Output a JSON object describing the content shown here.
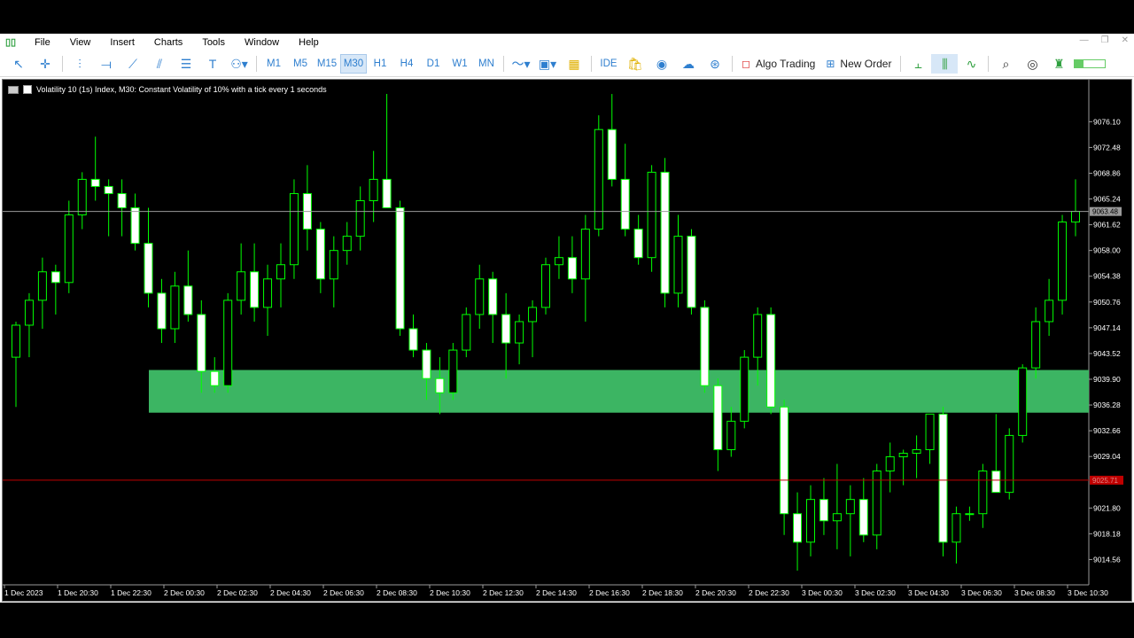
{
  "menu": [
    "File",
    "View",
    "Insert",
    "Charts",
    "Tools",
    "Window",
    "Help"
  ],
  "window_controls": [
    "—",
    "❐",
    "✕"
  ],
  "toolbar": {
    "timeframes": [
      "M1",
      "M5",
      "M15",
      "M30",
      "H1",
      "H4",
      "D1",
      "W1",
      "MN"
    ],
    "active_timeframe": "M30",
    "ide_label": "IDE",
    "algo_trading_label": "Algo Trading",
    "new_order_label": "New Order"
  },
  "chart": {
    "title": "Volatility 10 (1s) Index, M30:  Constant Volatility of 10% with a tick every 1 seconds",
    "current_price_label": "9063.48",
    "red_line_label": "9025.71",
    "background": "#000000",
    "bull_color": "#00ff00",
    "bear_fill": "#ffffff",
    "zone_color": "#3cb563",
    "red_line_color": "#c00000"
  },
  "chart_data": {
    "type": "candlestick",
    "title": "Volatility 10 (1s) Index, M30",
    "ylim": [
      9011.0,
      9082.0
    ],
    "y_ticks": [
      "9076.10",
      "9072.48",
      "9068.86",
      "9065.24",
      "9061.62",
      "9058.00",
      "9054.38",
      "9050.76",
      "9047.14",
      "9043.52",
      "9039.90",
      "9036.28",
      "9032.66",
      "9029.04",
      "9021.80",
      "9018.18",
      "9014.56"
    ],
    "x_ticks": [
      "1 Dec 2023",
      "1 Dec 20:30",
      "1 Dec 22:30",
      "2 Dec 00:30",
      "2 Dec 02:30",
      "2 Dec 04:30",
      "2 Dec 06:30",
      "2 Dec 08:30",
      "2 Dec 10:30",
      "2 Dec 12:30",
      "2 Dec 14:30",
      "2 Dec 16:30",
      "2 Dec 18:30",
      "2 Dec 20:30",
      "2 Dec 22:30",
      "3 Dec 00:30",
      "3 Dec 02:30",
      "3 Dec 04:30",
      "3 Dec 06:30",
      "3 Dec 08:30",
      "3 Dec 10:30"
    ],
    "zone": {
      "low": 9035.2,
      "high": 9041.2
    },
    "horizontal_lines": [
      {
        "price": 9063.48,
        "color": "#9a9a9a"
      },
      {
        "price": 9025.71,
        "color": "#c00000"
      }
    ],
    "candles": [
      [
        9043.0,
        9048.0,
        9036.0,
        9047.5
      ],
      [
        9047.5,
        9052.0,
        9043.0,
        9051.0
      ],
      [
        9051.0,
        9057.0,
        9047.0,
        9055.0
      ],
      [
        9055.0,
        9056.0,
        9049.0,
        9053.5
      ],
      [
        9053.5,
        9065.0,
        9052.0,
        9063.0
      ],
      [
        9063.0,
        9069.0,
        9061.0,
        9068.0
      ],
      [
        9068.0,
        9074.0,
        9065.0,
        9067.0
      ],
      [
        9067.0,
        9068.0,
        9060.0,
        9066.0
      ],
      [
        9066.0,
        9068.0,
        9060.0,
        9064.0
      ],
      [
        9064.0,
        9066.0,
        9058.0,
        9059.0
      ],
      [
        9059.0,
        9064.0,
        9050.0,
        9052.0
      ],
      [
        9052.0,
        9054.0,
        9045.0,
        9047.0
      ],
      [
        9047.0,
        9055.0,
        9045.0,
        9053.0
      ],
      [
        9053.0,
        9058.0,
        9048.0,
        9049.0
      ],
      [
        9049.0,
        9051.0,
        9038.0,
        9041.0
      ],
      [
        9041.0,
        9043.0,
        9038.0,
        9039.0
      ],
      [
        9039.0,
        9052.0,
        9038.0,
        9051.0
      ],
      [
        9051.0,
        9059.0,
        9049.0,
        9055.0
      ],
      [
        9055.0,
        9059.0,
        9048.0,
        9050.0
      ],
      [
        9050.0,
        9056.0,
        9046.0,
        9054.0
      ],
      [
        9054.0,
        9059.0,
        9050.0,
        9056.0
      ],
      [
        9056.0,
        9068.0,
        9054.0,
        9066.0
      ],
      [
        9066.0,
        9070.0,
        9058.0,
        9061.0
      ],
      [
        9061.0,
        9062.0,
        9052.0,
        9054.0
      ],
      [
        9054.0,
        9060.0,
        9050.0,
        9058.0
      ],
      [
        9058.0,
        9062.0,
        9056.0,
        9060.0
      ],
      [
        9060.0,
        9067.0,
        9058.0,
        9065.0
      ],
      [
        9065.0,
        9072.0,
        9062.0,
        9068.0
      ],
      [
        9068.0,
        9080.0,
        9064.0,
        9064.0
      ],
      [
        9064.0,
        9065.0,
        9046.0,
        9047.0
      ],
      [
        9047.0,
        9049.0,
        9043.0,
        9044.0
      ],
      [
        9044.0,
        9045.0,
        9037.0,
        9040.0
      ],
      [
        9040.0,
        9043.0,
        9035.0,
        9038.0
      ],
      [
        9038.0,
        9045.0,
        9037.0,
        9044.0
      ],
      [
        9044.0,
        9050.0,
        9043.0,
        9049.0
      ],
      [
        9049.0,
        9056.0,
        9047.0,
        9054.0
      ],
      [
        9054.0,
        9055.0,
        9045.0,
        9049.0
      ],
      [
        9049.0,
        9052.0,
        9040.0,
        9045.0
      ],
      [
        9045.0,
        9049.0,
        9042.0,
        9048.0
      ],
      [
        9048.0,
        9051.0,
        9043.0,
        9050.0
      ],
      [
        9050.0,
        9057.0,
        9049.0,
        9056.0
      ],
      [
        9056.0,
        9060.0,
        9054.0,
        9057.0
      ],
      [
        9057.0,
        9060.0,
        9052.0,
        9054.0
      ],
      [
        9054.0,
        9063.0,
        9048.0,
        9061.0
      ],
      [
        9061.0,
        9077.0,
        9060.0,
        9075.0
      ],
      [
        9075.0,
        9080.0,
        9067.0,
        9068.0
      ],
      [
        9068.0,
        9073.0,
        9060.0,
        9061.0
      ],
      [
        9061.0,
        9063.0,
        9056.0,
        9057.0
      ],
      [
        9057.0,
        9070.0,
        9055.0,
        9069.0
      ],
      [
        9069.0,
        9071.0,
        9050.0,
        9052.0
      ],
      [
        9052.0,
        9063.0,
        9050.0,
        9060.0
      ],
      [
        9060.0,
        9061.0,
        9049.0,
        9050.0
      ],
      [
        9050.0,
        9051.0,
        9038.0,
        9039.0
      ],
      [
        9039.0,
        9040.0,
        9027.0,
        9030.0
      ],
      [
        9030.0,
        9036.0,
        9029.0,
        9034.0
      ],
      [
        9034.0,
        9044.0,
        9033.0,
        9043.0
      ],
      [
        9043.0,
        9050.0,
        9039.0,
        9049.0
      ],
      [
        9049.0,
        9050.0,
        9035.0,
        9036.0
      ],
      [
        9036.0,
        9037.0,
        9018.0,
        9021.0
      ],
      [
        9021.0,
        9024.0,
        9013.0,
        9017.0
      ],
      [
        9017.0,
        9025.0,
        9015.0,
        9023.0
      ],
      [
        9023.0,
        9026.0,
        9018.0,
        9020.0
      ],
      [
        9020.0,
        9028.0,
        9016.0,
        9021.0
      ],
      [
        9021.0,
        9025.0,
        9015.0,
        9023.0
      ],
      [
        9023.0,
        9026.0,
        9017.0,
        9018.0
      ],
      [
        9018.0,
        9028.0,
        9016.0,
        9027.0
      ],
      [
        9027.0,
        9031.0,
        9024.0,
        9029.0
      ],
      [
        9029.0,
        9030.0,
        9025.0,
        9029.5
      ],
      [
        9029.5,
        9032.0,
        9026.0,
        9030.0
      ],
      [
        9030.0,
        9035.0,
        9028.0,
        9035.0
      ],
      [
        9035.0,
        9036.0,
        9015.0,
        9017.0
      ],
      [
        9017.0,
        9022.0,
        9014.0,
        9021.0
      ],
      [
        9021.0,
        9022.0,
        9020.0,
        9021.0
      ],
      [
        9021.0,
        9028.0,
        9019.0,
        9027.0
      ],
      [
        9027.0,
        9035.0,
        9025.0,
        9024.0
      ],
      [
        9024.0,
        9033.0,
        9023.0,
        9032.0
      ],
      [
        9032.0,
        9042.0,
        9031.0,
        9041.5
      ],
      [
        9041.5,
        9050.0,
        9040.0,
        9048.0
      ],
      [
        9048.0,
        9054.0,
        9046.0,
        9051.0
      ],
      [
        9051.0,
        9063.0,
        9049.0,
        9062.0
      ],
      [
        9062.0,
        9068.0,
        9060.0,
        9063.5
      ]
    ]
  }
}
